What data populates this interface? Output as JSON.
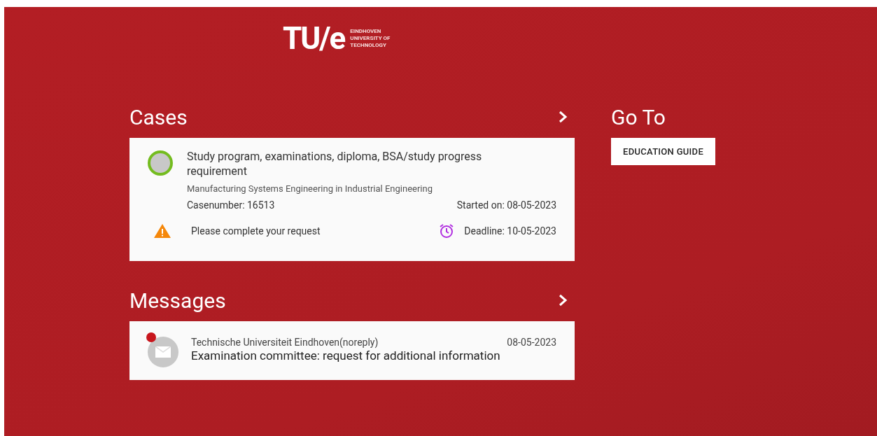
{
  "logo": {
    "mark": "TU/e",
    "lines": [
      "EINDHOVEN",
      "UNIVERSITY OF",
      "TECHNOLOGY"
    ]
  },
  "cases": {
    "title": "Cases",
    "items": [
      {
        "title": "Study program, examinations, diploma, BSA/study progress requirement",
        "subtitle": "Manufacturing Systems Engineering in Industrial Engineering",
        "casenumber": "Casenumber: 16513",
        "started": "Started on: 08-05-2023",
        "warning": "Please complete your request",
        "deadline": "Deadline: 10-05-2023"
      }
    ]
  },
  "messages": {
    "title": "Messages",
    "items": [
      {
        "sender": "Technische Universiteit Eindhoven(noreply)",
        "date": "08-05-2023",
        "subject": "Examination committee: request for additional information",
        "unread": true
      }
    ]
  },
  "goto": {
    "title": "Go To",
    "buttons": [
      "EDUCATION GUIDE"
    ]
  }
}
